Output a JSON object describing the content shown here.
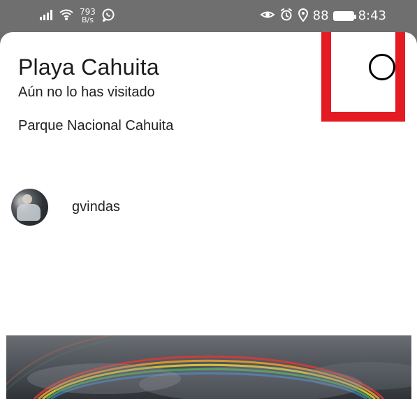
{
  "status_bar": {
    "speed_value": "793",
    "speed_unit": "B/s",
    "battery_percent_text": "88",
    "time": "8:43",
    "icons": [
      "signal-icon",
      "wifi-icon",
      "whatsapp-icon",
      "eye-icon",
      "alarm-icon",
      "location-icon",
      "battery-icon"
    ]
  },
  "place": {
    "title": "Playa Cahuita",
    "visit_status": "Aún no lo has visitado",
    "park": "Parque Nacional Cahuita"
  },
  "author": {
    "username": "gvindas"
  },
  "colors": {
    "highlight": "#e51b24",
    "status_bar_bg": "#6f6f6f"
  }
}
